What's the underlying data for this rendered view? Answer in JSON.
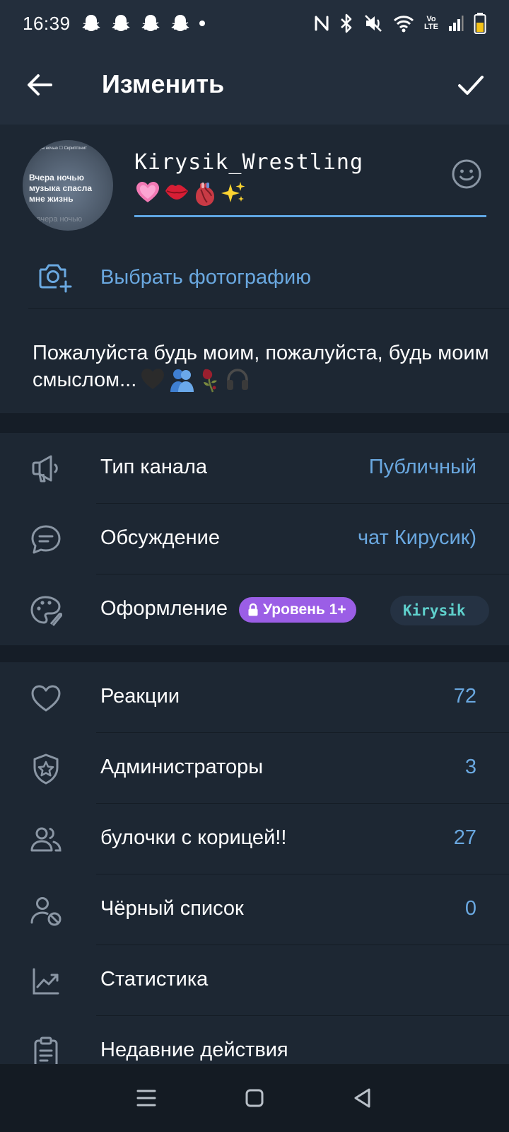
{
  "status_bar": {
    "time": "16:39",
    "notification_icons": [
      "snapchat-icon",
      "snapchat-icon",
      "snapchat-icon",
      "snapchat-icon"
    ],
    "right_icons": [
      "nfc-icon",
      "bluetooth-icon",
      "mute-icon",
      "wifi-icon",
      "volte-icon",
      "signal-icon",
      "battery-icon"
    ],
    "volte_text": "Vo LTE"
  },
  "header": {
    "title": "Изменить"
  },
  "profile": {
    "avatar_caption_top": "Вчера ночью ☐ Скриптонит",
    "avatar_caption": "Вчера ночью музыка спасла мне жизнь",
    "avatar_caption_bottom": "вчера ночью",
    "channel_name": "Kirysik_Wrestling",
    "name_emoji": [
      "💗",
      "💋",
      "🫀",
      "✨"
    ],
    "choose_photo_label": "Выбрать фотографию",
    "bio": "Пожалуйста будь моим, пожалуйста, будь моим смыслом...",
    "bio_emoji": [
      "🖤",
      "🫂",
      "🥀",
      "🎧"
    ]
  },
  "settings_group1": [
    {
      "icon": "megaphone-icon",
      "label": "Тип канала",
      "value": "Публичный"
    },
    {
      "icon": "chat-bubble-icon",
      "label": "Обсуждение",
      "value": "чат Кирусик)"
    },
    {
      "icon": "palette-icon",
      "label": "Оформление",
      "badge": "Уровень 1+",
      "chip": "Kirysik"
    }
  ],
  "settings_group2": [
    {
      "icon": "heart-icon",
      "label": "Реакции",
      "value": "72"
    },
    {
      "icon": "shield-star-icon",
      "label": "Администраторы",
      "value": "3"
    },
    {
      "icon": "users-icon",
      "label": "булочки с корицей!!",
      "value": "27"
    },
    {
      "icon": "user-block-icon",
      "label": "Чёрный список",
      "value": "0"
    },
    {
      "icon": "chart-icon",
      "label": "Статистика"
    },
    {
      "icon": "clipboard-icon",
      "label": "Недавние действия"
    }
  ],
  "colors": {
    "background": "#1d2733",
    "header": "#232e3c",
    "accent": "#6aa8e0",
    "badge": "#9b5ee6",
    "chip_text": "#5fd0cc"
  }
}
